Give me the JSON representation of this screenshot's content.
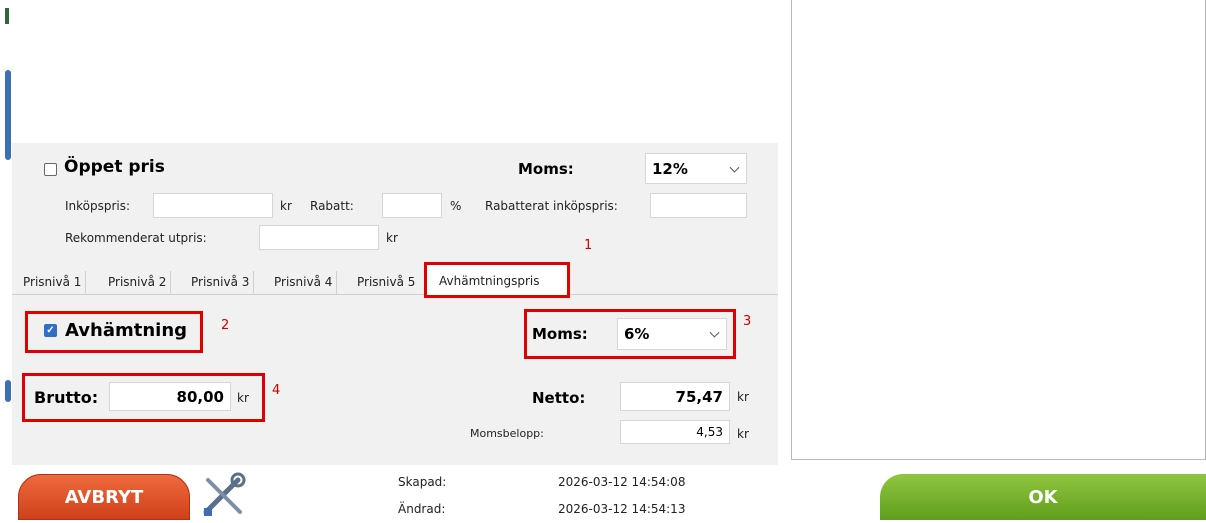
{
  "open_price": {
    "label": "Öppet pris",
    "checked": false
  },
  "vat_top": {
    "label": "Moms:",
    "value": "12%"
  },
  "purchase": {
    "inkopspris_label": "Inköpspris:",
    "inkopspris_value": "",
    "kr1": "kr",
    "rabatt_label": "Rabatt:",
    "rabatt_value": "",
    "percent": "%",
    "rabatterat_label": "Rabatterat inköpspris:",
    "rabatterat_value": "",
    "rek_label": "Rekommenderat utpris:",
    "rek_value": "",
    "kr2": "kr"
  },
  "tabs": [
    {
      "label": "Prisnivå 1"
    },
    {
      "label": "Prisnivå 2"
    },
    {
      "label": "Prisnivå 3"
    },
    {
      "label": "Prisnivå 4"
    },
    {
      "label": "Prisnivå 5"
    },
    {
      "label": "Avhämtningspris",
      "active": true
    }
  ],
  "pickup": {
    "label": "Avhämtning",
    "checked": true,
    "moms_label": "Moms:",
    "moms_value": "6%",
    "brutto_label": "Brutto:",
    "brutto_value": "80,00",
    "brutto_unit": "kr",
    "netto_label": "Netto:",
    "netto_value": "75,47",
    "netto_unit": "kr",
    "momsbelopp_label": "Momsbelopp:",
    "momsbelopp_value": "4,53",
    "momsbelopp_unit": "kr"
  },
  "annotations": {
    "n1": "1",
    "n2": "2",
    "n3": "3",
    "n4": "4"
  },
  "footer": {
    "cancel_label": "AVBRYT",
    "ok_label": "OK",
    "created_label": "Skapad:",
    "created_value": "2026-03-12 14:54:08",
    "modified_label": "Ändrad:",
    "modified_value": "2026-03-12 14:54:13"
  },
  "colors": {
    "annotation_red": "#e00000",
    "ok_green": "#6fad26",
    "cancel_orange": "#e0552a",
    "checkbox_blue": "#2f6fc9"
  }
}
